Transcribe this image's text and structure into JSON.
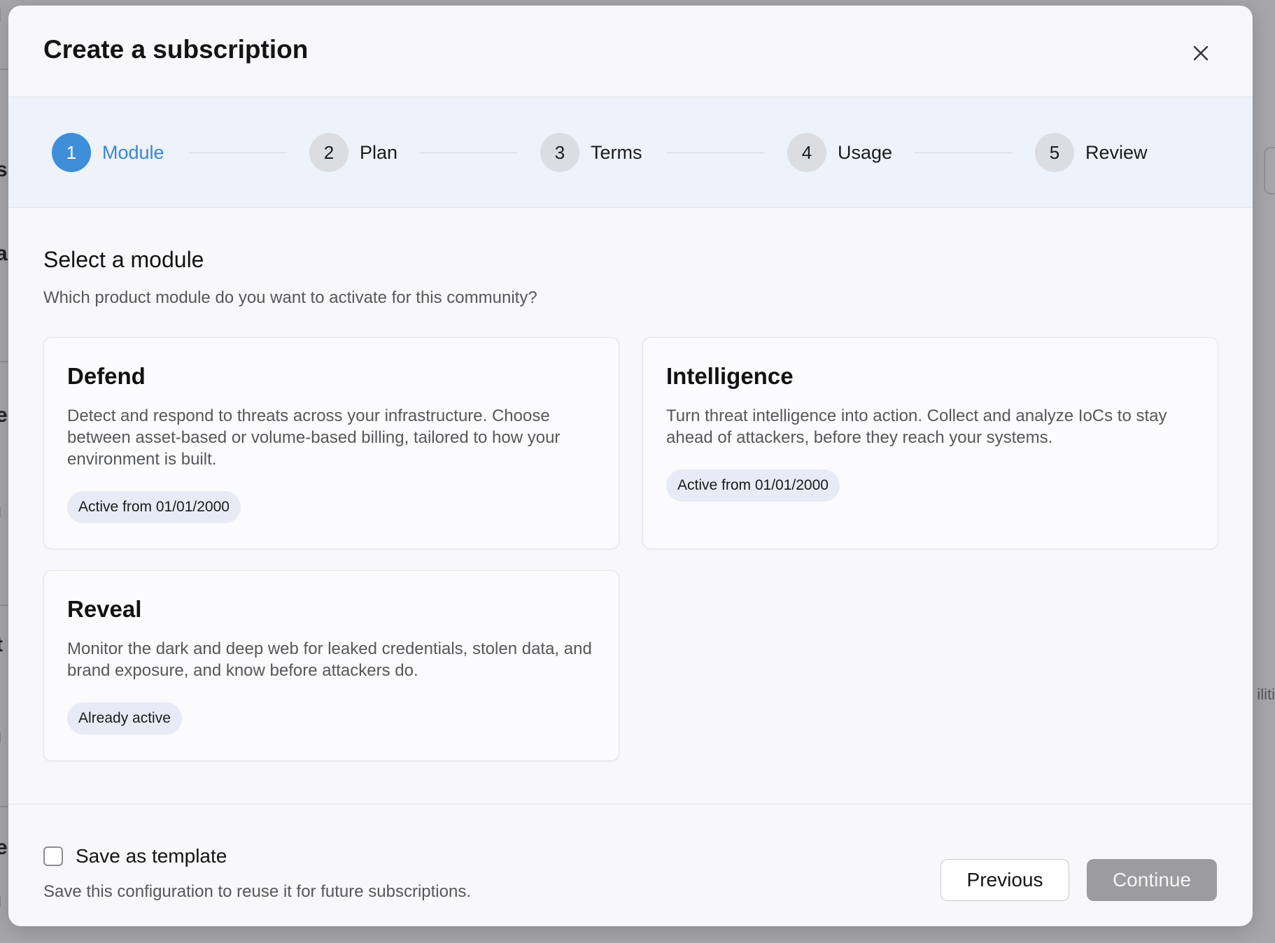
{
  "modal": {
    "title": "Create a subscription",
    "close_icon": "close-icon"
  },
  "stepper": {
    "steps": [
      {
        "number": "1",
        "label": "Module",
        "active": true
      },
      {
        "number": "2",
        "label": "Plan",
        "active": false
      },
      {
        "number": "3",
        "label": "Terms",
        "active": false
      },
      {
        "number": "4",
        "label": "Usage",
        "active": false
      },
      {
        "number": "5",
        "label": "Review",
        "active": false
      }
    ]
  },
  "content": {
    "title": "Select a module",
    "description": "Which product module do you want to activate for this community?",
    "modules": [
      {
        "name": "Defend",
        "description": "Detect and respond to threats across your infrastructure. Choose between asset-based or volume-based billing, tailored to how your environment is built.",
        "badge": "Active from 01/01/2000"
      },
      {
        "name": "Intelligence",
        "description": "Turn threat intelligence into action. Collect and analyze IoCs to stay ahead of attackers, before they reach your systems.",
        "badge": "Active from 01/01/2000"
      },
      {
        "name": "Reveal",
        "description": "Monitor the dark and deep web for leaked credentials, stolen data, and brand exposure, and know before attackers do.",
        "badge": "Already active"
      }
    ]
  },
  "footer": {
    "save_template_label": "Save as template",
    "save_template_checked": false,
    "save_template_hint": "Save this configuration to reuse it for future subscriptions.",
    "previous_label": "Previous",
    "continue_label": "Continue"
  },
  "colors": {
    "accent": "#3e8ed9",
    "stepper_bg": "#eef2fa",
    "badge_bg": "#e8ebf6",
    "continue_disabled": "#9c9c9e"
  }
}
